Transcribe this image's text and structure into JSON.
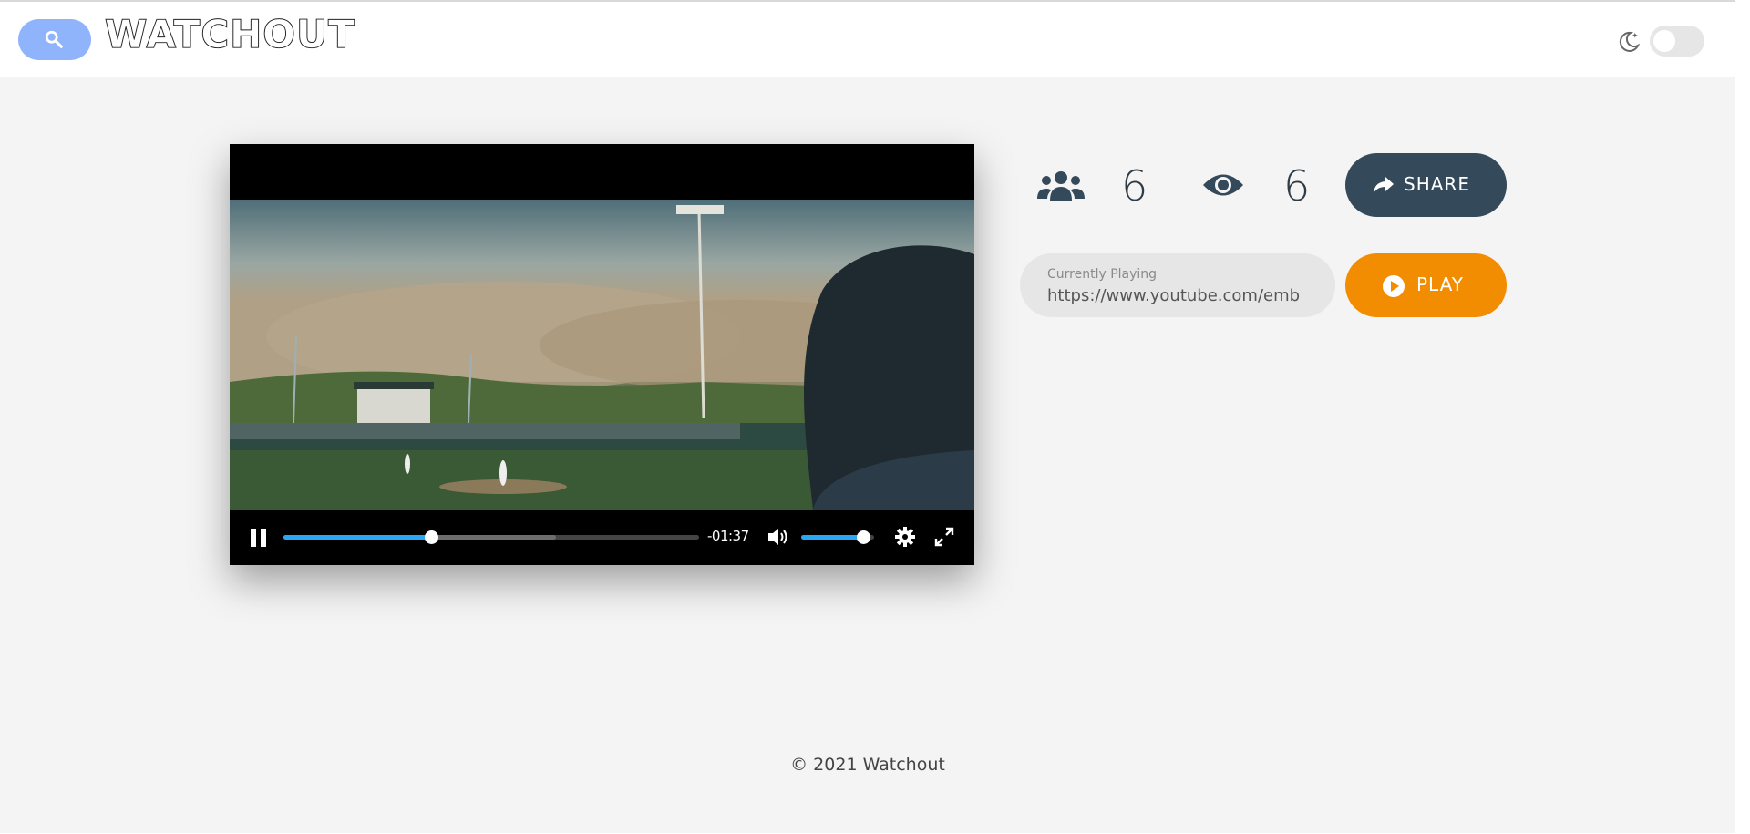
{
  "app": {
    "logo_text": "WATCHOUT"
  },
  "header": {
    "search_icon": "search-icon",
    "theme_icon": "moon-stars-icon",
    "dark_mode_on": false
  },
  "player": {
    "time_remaining": "-01:37",
    "progress": 0.355,
    "buffered": 0.655,
    "volume": 0.85,
    "icons": [
      "pause-icon",
      "volume-icon",
      "settings-icon",
      "fullscreen-icon"
    ]
  },
  "stats": {
    "users_count": "6",
    "viewers_count": "6"
  },
  "share": {
    "label": "SHARE"
  },
  "url_field": {
    "label": "Currently Playing",
    "value": "https://www.youtube.com/emb"
  },
  "play": {
    "label": "PLAY"
  },
  "footer": {
    "text": "© 2021 Watchout"
  },
  "colors": {
    "accent": "#f28c00",
    "dark": "#34495a",
    "search": "#8fb4fb",
    "progress": "#2aa6f4"
  }
}
